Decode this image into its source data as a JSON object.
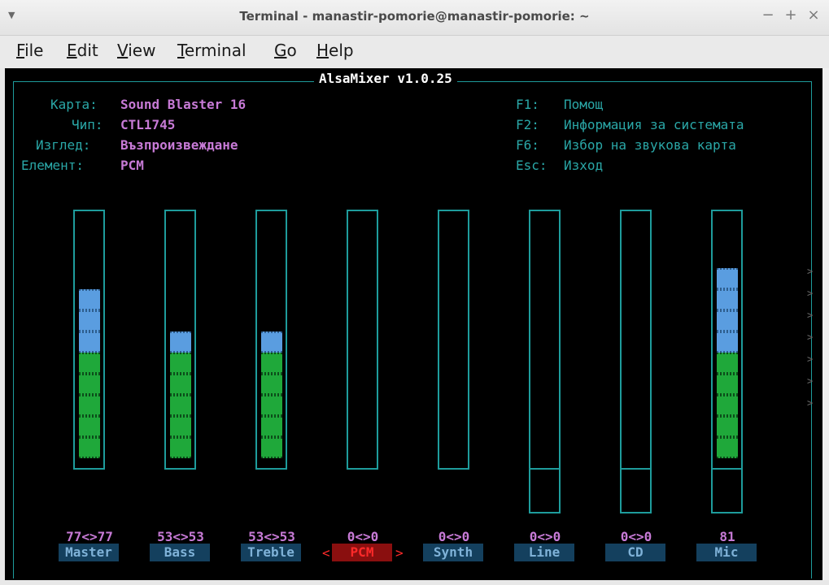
{
  "window": {
    "title": "Terminal - manastir-pomorie@manastir-pomorie: ~",
    "menu_icon": "dropdown-arrow-icon",
    "minimize": "−",
    "maximize": "+",
    "close": "×"
  },
  "menubar": {
    "items": [
      {
        "acc": "F",
        "rest": "ile"
      },
      {
        "acc": "E",
        "rest": "dit"
      },
      {
        "acc": "V",
        "rest": "iew"
      },
      {
        "acc": "T",
        "rest": "erminal"
      },
      {
        "acc": "G",
        "rest": "o"
      },
      {
        "acc": "H",
        "rest": "elp"
      }
    ]
  },
  "mixer": {
    "title": "AlsaMixer v1.0.25",
    "info": {
      "card_label": "Карта:",
      "card_value": "Sound Blaster 16",
      "chip_label": "Чип:",
      "chip_value": "CTL1745",
      "view_label": "Изглед:",
      "view_value": "Възпроизвеждане",
      "item_label": "Елемент:",
      "item_value": "PCM"
    },
    "keys": [
      {
        "key": "F1:",
        "desc": "Помощ"
      },
      {
        "key": "F2:",
        "desc": "Информация за системата"
      },
      {
        "key": "F6:",
        "desc": "Избор на звукова карта"
      },
      {
        "key": "Esc:",
        "desc": "Изход"
      }
    ],
    "channels": [
      {
        "name": "Master",
        "value_text": "77<>77",
        "level": 0.77
      },
      {
        "name": "Bass",
        "value_text": "53<>53",
        "level": 0.53
      },
      {
        "name": "Treble",
        "value_text": "53<>53",
        "level": 0.53
      },
      {
        "name": "PCM",
        "value_text": "0<>0",
        "level": 0
      },
      {
        "name": "Synth",
        "value_text": "0<>0",
        "level": 0
      },
      {
        "name": "Line",
        "value_text": "0<>0",
        "level": 0
      },
      {
        "name": "CD",
        "value_text": "0<>0",
        "level": 0
      },
      {
        "name": "Mic",
        "value_text": "81",
        "level": 0.81
      }
    ],
    "selected_channel": "PCM",
    "selector_left": "<",
    "selector_right": ">",
    "more_marker": ">"
  },
  "colors": {
    "frame": "#1e9c9c",
    "value_text": "#c77ad6",
    "green_level": "#1fa83a",
    "blue_level": "#5a9de0",
    "selected": "#ff2a2a"
  }
}
